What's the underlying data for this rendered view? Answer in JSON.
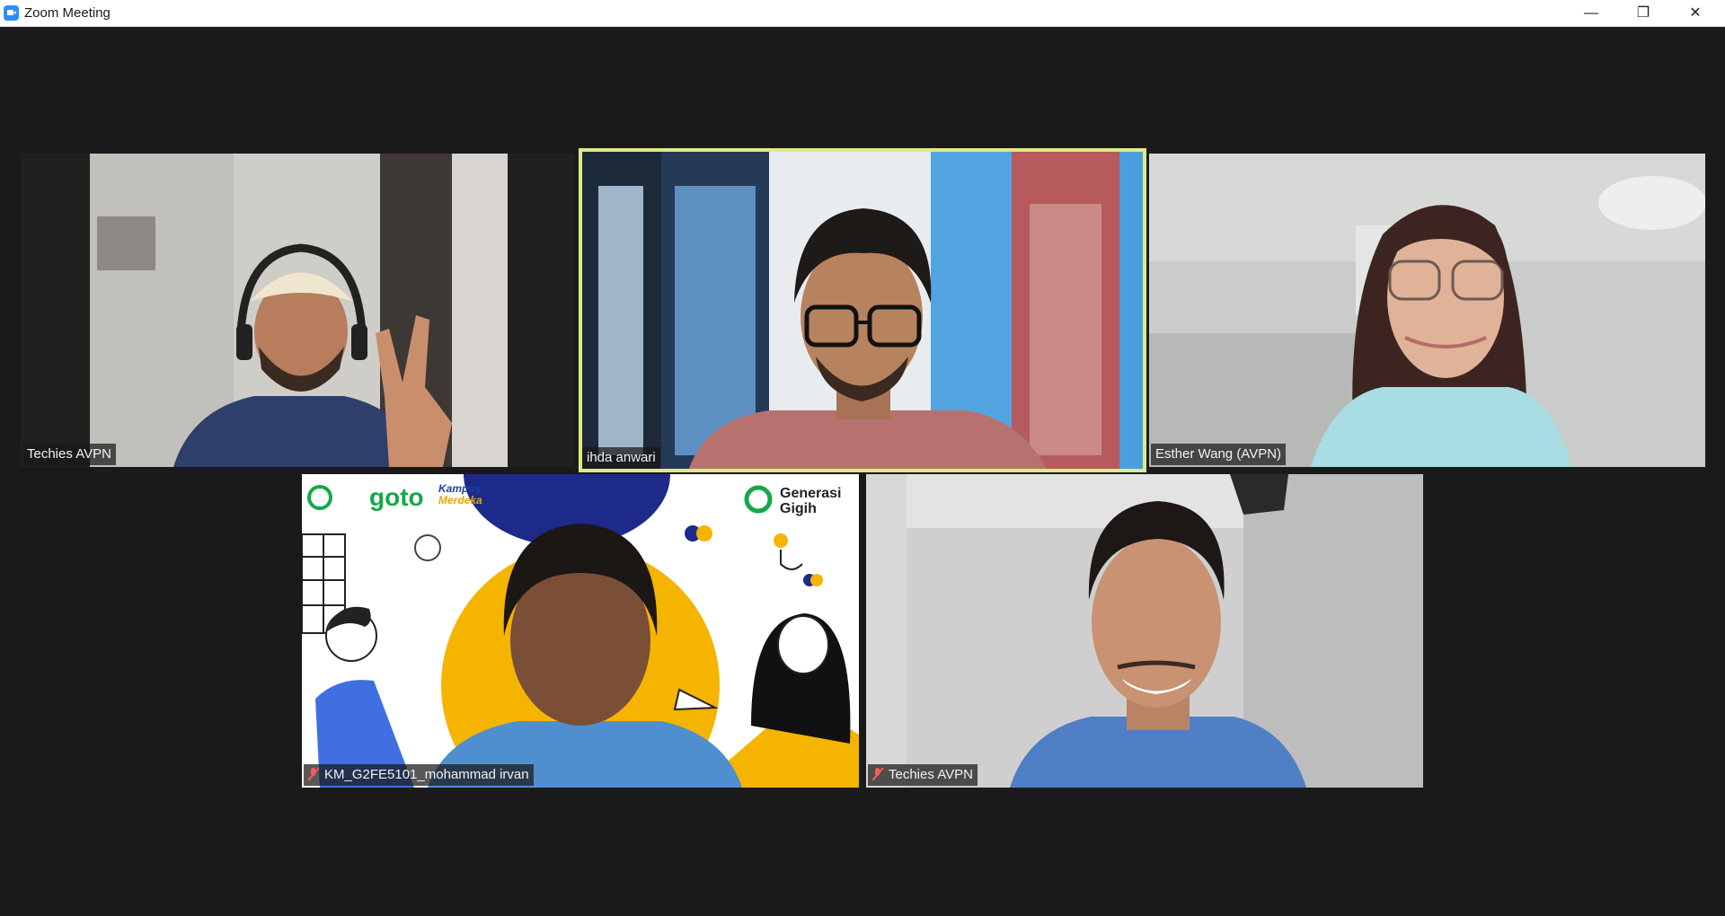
{
  "window": {
    "title": "Zoom Meeting",
    "controls": [
      "minimize-icon",
      "restore-icon",
      "close-icon"
    ]
  },
  "participants": [
    {
      "name": "Techies AVPN",
      "muted": false,
      "active_speaker": false
    },
    {
      "name": "ihda anwari",
      "muted": false,
      "active_speaker": true
    },
    {
      "name": "Esther Wang (AVPN)",
      "muted": false,
      "active_speaker": false
    },
    {
      "name": "KM_G2FE5101_mohammad irvan",
      "muted": true,
      "active_speaker": false
    },
    {
      "name": "Techies AVPN",
      "muted": true,
      "active_speaker": false
    }
  ],
  "background_graphics": {
    "brand_1": "goto",
    "brand_2_line1": "Kampus",
    "brand_2_line2": "Merdeka",
    "program_line1": "Generasi",
    "program_line2": "Gigih"
  },
  "colors": {
    "active_border": "#dfe98a",
    "muted_icon": "#ff5a5a",
    "zoom_blue": "#2d8cff"
  }
}
